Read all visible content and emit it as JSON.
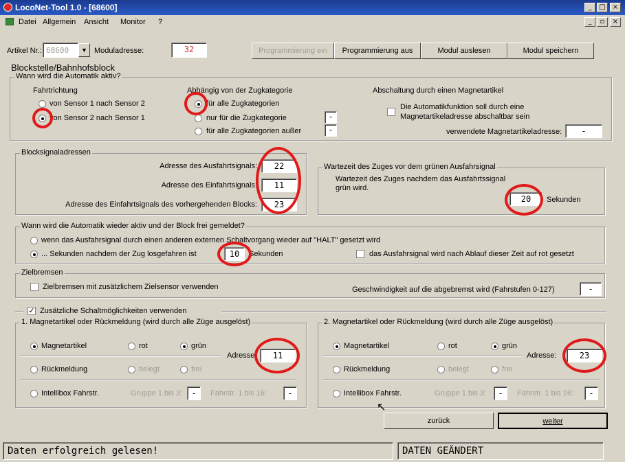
{
  "window": {
    "title": "LocoNet-Tool 1.0 - [68600]"
  },
  "menu": [
    "Datei",
    "Allgemein",
    "Ansicht",
    "Monitor",
    "?"
  ],
  "toolbar": {
    "artikel_label": "Artikel Nr.:",
    "artikel_value": "68600",
    "moduladresse_label": "Moduladresse:",
    "moduladresse_value": "32",
    "btn_prog_ein": "Programmierung ein",
    "btn_prog_aus": "Programmierung aus",
    "btn_auslesen": "Modul auslesen",
    "btn_speichern": "Modul speichern"
  },
  "section_title": "Blockstelle/Bahnhofsblock",
  "automatik": {
    "group": "Wann wird die Automatik aktiv?",
    "fahrtrichtung": "Fahrtrichtung",
    "fr_opt1": "von Sensor 1 nach Sensor 2",
    "fr_opt2": "von Sensor 2 nach Sensor 1",
    "zug_title": "Abhängig von der Zugkategorie",
    "zug_opt1": "für alle Zugkategorien",
    "zug_opt2": "nur für die Zugkategorie",
    "zug_opt3": "für alle Zugkategorien außer",
    "zug_val2": "-",
    "zug_val3": "-",
    "absch_title": "Abschaltung durch einen Magnetartikel",
    "absch_check1": "Die Automatikfunktion soll durch eine",
    "absch_check2": "Magnetartikeladresse abschaltbar sein",
    "absch_addr_label": "verwendete Magnetartikeladresse:",
    "absch_addr_value": "-"
  },
  "blocksignal": {
    "group": "Blocksignaladressen",
    "ausfahrt_label": "Adresse des Ausfahrtsignals:",
    "ausfahrt_value": "22",
    "einfahrt_label": "Adresse des Einfahrtsignals:",
    "einfahrt_value": "11",
    "vorher_label": "Adresse des Einfahrtsignals des vorhergehenden Blocks:",
    "vorher_value": "23"
  },
  "wartezeit": {
    "group": "Wartezeit des Zuges vor dem grünen Ausfahrsignal",
    "text1": "Wartezeit des Zuges nachdem das Ausfahrtssignal",
    "text2": "grün wird.",
    "value": "20",
    "unit": "Sekunden"
  },
  "frei": {
    "group": "Wann wird die Automatik wieder aktiv und der Block frei gemeldet?",
    "opt1": "wenn das Ausfahrsignal durch einen anderen externen Schaltvorgang wieder auf \"HALT\" gesetzt wird",
    "opt2": "... Sekunden nachdem der Zug losgefahren ist",
    "opt2_value": "10",
    "opt2_unit": "Sekunden",
    "check": "das Ausfahrsignal wird nach Ablauf dieser Zeit auf rot gesetzt"
  },
  "zielbremsen": {
    "group": "Zielbremsen",
    "check": "Zielbremsen mit zusätzlichem Zielsensor verwenden",
    "speed_label": "Geschwindigkeit auf die abgebremst wird (Fahrstufen 0-127)",
    "speed_value": "-"
  },
  "zusatz": {
    "check_mark": "✓",
    "check": "Zusätzliche Schaltmöglichkeiten verwenden",
    "g1": {
      "title": "1. Magnetartikel oder Rückmeldung (wird durch alle Züge ausgelöst)",
      "magnet": "Magnetartikel",
      "rot": "rot",
      "gruen": "grün",
      "adresse_label": "Adresse:",
      "adresse_value": "11",
      "rueck": "Rückmeldung",
      "belegt": "belegt",
      "frei": "frei",
      "ib": "Intellibox Fahrstr.",
      "gruppe": "Gruppe 1 bis 3:",
      "gruppe_val": "-",
      "fahrstr": "Fahrstr. 1 bis 16:",
      "fahrstr_val": "-"
    },
    "g2": {
      "title": "2. Magnetartikel oder Rückmeldung (wird durch alle Züge ausgelöst)",
      "magnet": "Magnetartikel",
      "rot": "rot",
      "gruen": "grün",
      "adresse_label": "Adresse:",
      "adresse_value": "23",
      "rueck": "Rückmeldung",
      "belegt": "belegt",
      "frei": "frei",
      "ib": "Intellibox Fahrstr.",
      "gruppe": "Gruppe 1 bis 3:",
      "gruppe_val": "-",
      "fahrstr": "Fahrstr. 1 bis 16:",
      "fahrstr_val": "-"
    }
  },
  "nav": {
    "back": "zurück",
    "next": "weiter"
  },
  "status": {
    "left": "Daten erfolgreich gelesen!",
    "right": "DATEN GEÄNDERT"
  },
  "colors": {
    "annotation": "#e01a1a",
    "titlebar": "#1b3b8f"
  }
}
